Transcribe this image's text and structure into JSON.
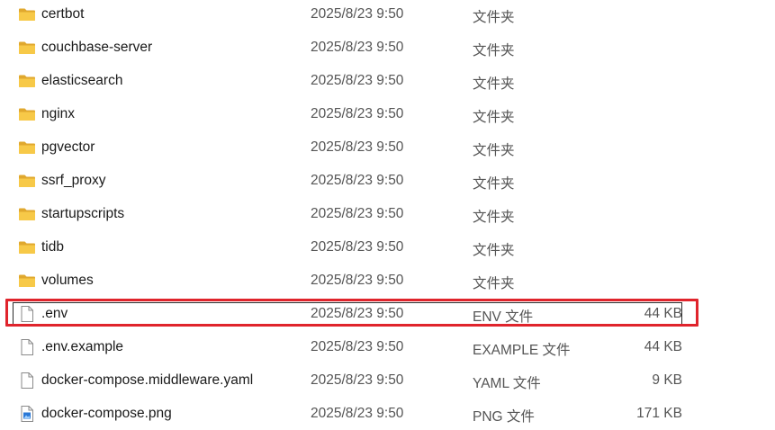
{
  "files": [
    {
      "name": "certbot",
      "date": "2025/8/23 9:50",
      "type": "文件夹",
      "size": "",
      "icon": "folder-icon"
    },
    {
      "name": "couchbase-server",
      "date": "2025/8/23 9:50",
      "type": "文件夹",
      "size": "",
      "icon": "folder-icon"
    },
    {
      "name": "elasticsearch",
      "date": "2025/8/23 9:50",
      "type": "文件夹",
      "size": "",
      "icon": "folder-icon"
    },
    {
      "name": "nginx",
      "date": "2025/8/23 9:50",
      "type": "文件夹",
      "size": "",
      "icon": "folder-icon"
    },
    {
      "name": "pgvector",
      "date": "2025/8/23 9:50",
      "type": "文件夹",
      "size": "",
      "icon": "folder-icon"
    },
    {
      "name": "ssrf_proxy",
      "date": "2025/8/23 9:50",
      "type": "文件夹",
      "size": "",
      "icon": "folder-icon"
    },
    {
      "name": "startupscripts",
      "date": "2025/8/23 9:50",
      "type": "文件夹",
      "size": "",
      "icon": "folder-icon"
    },
    {
      "name": "tidb",
      "date": "2025/8/23 9:50",
      "type": "文件夹",
      "size": "",
      "icon": "folder-icon"
    },
    {
      "name": "volumes",
      "date": "2025/8/23 9:50",
      "type": "文件夹",
      "size": "",
      "icon": "folder-icon"
    },
    {
      "name": ".env",
      "date": "2025/8/23 9:50",
      "type": "ENV 文件",
      "size": "44 KB",
      "icon": "file-icon"
    },
    {
      "name": ".env.example",
      "date": "2025/8/23 9:50",
      "type": "EXAMPLE 文件",
      "size": "44 KB",
      "icon": "file-icon"
    },
    {
      "name": "docker-compose.middleware.yaml",
      "date": "2025/8/23 9:50",
      "type": "YAML 文件",
      "size": "9 KB",
      "icon": "file-icon"
    },
    {
      "name": "docker-compose.png",
      "date": "2025/8/23 9:50",
      "type": "PNG 文件",
      "size": "171 KB",
      "icon": "image-file-icon"
    }
  ],
  "selected_index": 9,
  "colors": {
    "folder": "#f2c14e",
    "folder_dark": "#e0a82e",
    "highlight": "#e0242c",
    "image_accent": "#2a78d6"
  }
}
